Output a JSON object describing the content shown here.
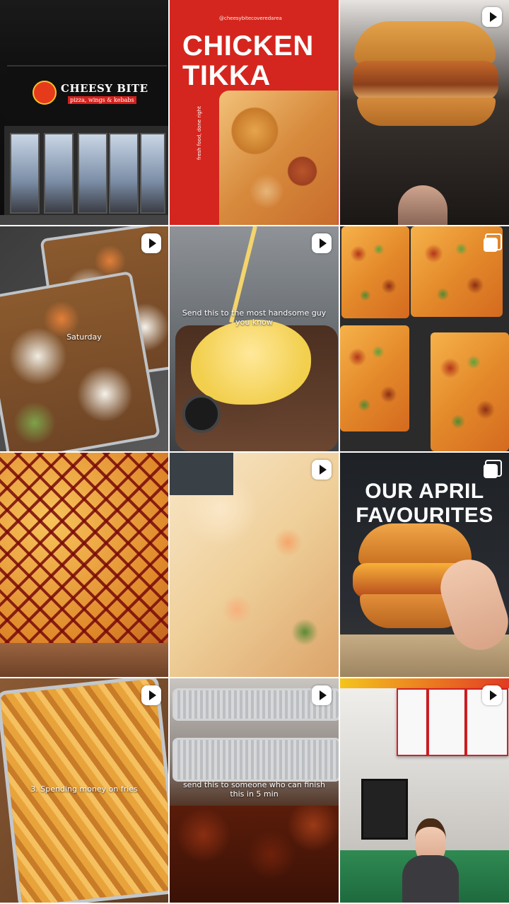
{
  "grid": {
    "tiles": [
      {
        "type": "photo",
        "brand": "CHEESY BITE",
        "brand_sub": "pizza, wings & kebabs",
        "overlay": ""
      },
      {
        "type": "carousel-hidden",
        "handle": "@cheesybitecoveredarea",
        "title_line1": "CHICKEN",
        "title_line2": "TIKKA",
        "side_text": "fresh food, done right",
        "overlay": ""
      },
      {
        "type": "reel",
        "icon": "reel-icon",
        "overlay": ""
      },
      {
        "type": "reel",
        "icon": "reel-icon",
        "overlay": "Saturday"
      },
      {
        "type": "reel",
        "icon": "reel-icon",
        "overlay": "Send this to the most handsome guy you know"
      },
      {
        "type": "carousel",
        "icon": "carousel-icon",
        "overlay": ""
      },
      {
        "type": "photo",
        "overlay": ""
      },
      {
        "type": "reel",
        "icon": "reel-icon",
        "overlay": ""
      },
      {
        "type": "carousel",
        "icon": "carousel-icon",
        "title_line1": "OUR APRIL",
        "title_line2": "FAVOURITES",
        "overlay": ""
      },
      {
        "type": "reel",
        "icon": "reel-icon",
        "overlay": "3. Spending money on fries"
      },
      {
        "type": "reel",
        "icon": "reel-icon",
        "overlay": "send this to someone who can finish this in 5 min"
      },
      {
        "type": "reel",
        "icon": "reel-icon",
        "overlay": ""
      }
    ]
  },
  "colors": {
    "tikka_red": "#d4261e",
    "reel_icon": "#ffffff"
  }
}
